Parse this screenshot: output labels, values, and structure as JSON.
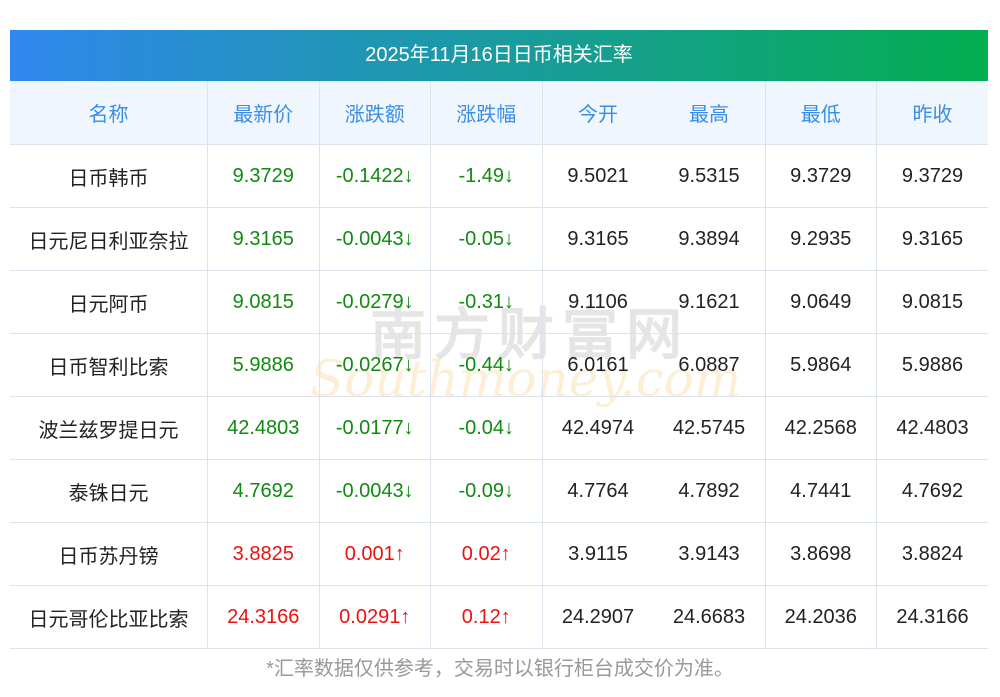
{
  "title": "2025年11月16日日币相关汇率",
  "headers": [
    "名称",
    "最新价",
    "涨跌额",
    "涨跌幅",
    "今开",
    "最高",
    "最低",
    "昨收"
  ],
  "rows": [
    [
      "日币韩币",
      "9.3729",
      "-0.1422↓",
      "-1.49↓",
      "9.5021",
      "9.5315",
      "9.3729",
      "9.3729",
      "down"
    ],
    [
      "日元尼日利亚奈拉",
      "9.3165",
      "-0.0043↓",
      "-0.05↓",
      "9.3165",
      "9.3894",
      "9.2935",
      "9.3165",
      "down"
    ],
    [
      "日元阿币",
      "9.0815",
      "-0.0279↓",
      "-0.31↓",
      "9.1106",
      "9.1621",
      "9.0649",
      "9.0815",
      "down"
    ],
    [
      "日币智利比索",
      "5.9886",
      "-0.0267↓",
      "-0.44↓",
      "6.0161",
      "6.0887",
      "5.9864",
      "5.9886",
      "down"
    ],
    [
      "波兰兹罗提日元",
      "42.4803",
      "-0.0177↓",
      "-0.04↓",
      "42.4974",
      "42.5745",
      "42.2568",
      "42.4803",
      "down"
    ],
    [
      "泰铢日元",
      "4.7692",
      "-0.0043↓",
      "-0.09↓",
      "4.7764",
      "4.7892",
      "4.7441",
      "4.7692",
      "down"
    ],
    [
      "日币苏丹镑",
      "3.8825",
      "0.001↑",
      "0.02↑",
      "3.9115",
      "3.9143",
      "3.8698",
      "3.8824",
      "up"
    ],
    [
      "日元哥伦比亚比索",
      "24.3166",
      "0.0291↑",
      "0.12↑",
      "24.2907",
      "24.6683",
      "24.2036",
      "24.3166",
      "up"
    ]
  ],
  "watermark": {
    "cn": "南方财富网",
    "en": "southmoney.com"
  },
  "footnote": "*汇率数据仅供参考，交易时以银行柜台成交价为准。"
}
